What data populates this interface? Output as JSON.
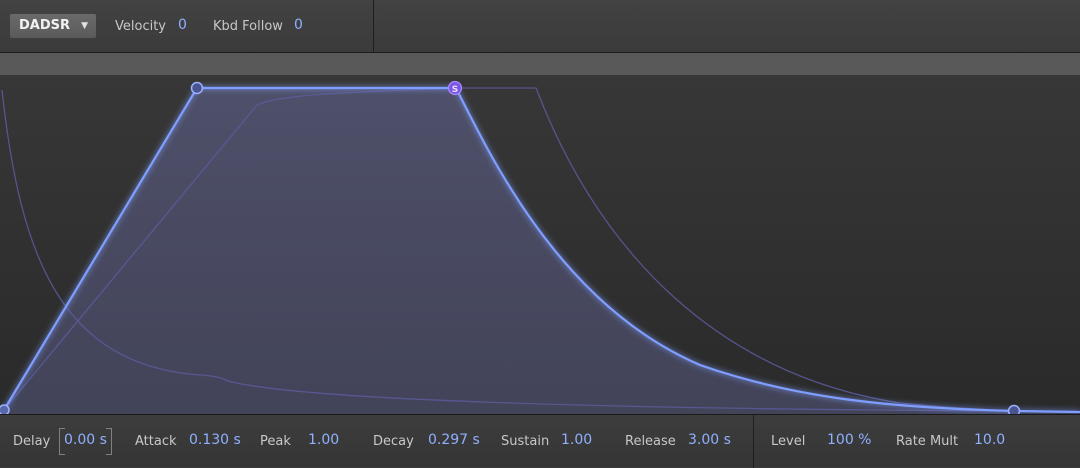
{
  "header": {
    "mode": "DADSR",
    "velocity_label": "Velocity",
    "velocity_value": "0",
    "kbd_follow_label": "Kbd Follow",
    "kbd_follow_value": "0"
  },
  "graph": {
    "sustain_marker": "S",
    "accent_color": "#7f9eff",
    "sustain_handle_color": "#7b55e6",
    "ghost_curve_color": "#5c5a9c"
  },
  "params": {
    "delay_label": "Delay",
    "delay_value": "0.00 s",
    "attack_label": "Attack",
    "attack_value": "0.130 s",
    "peak_label": "Peak",
    "peak_value": "1.00",
    "decay_label": "Decay",
    "decay_value": "0.297 s",
    "sustain_label": "Sustain",
    "sustain_value": "1.00",
    "release_label": "Release",
    "release_value": "3.00 s",
    "level_label": "Level",
    "level_value": "100 %",
    "rate_mult_label": "Rate Mult",
    "rate_mult_value": "10.0"
  }
}
